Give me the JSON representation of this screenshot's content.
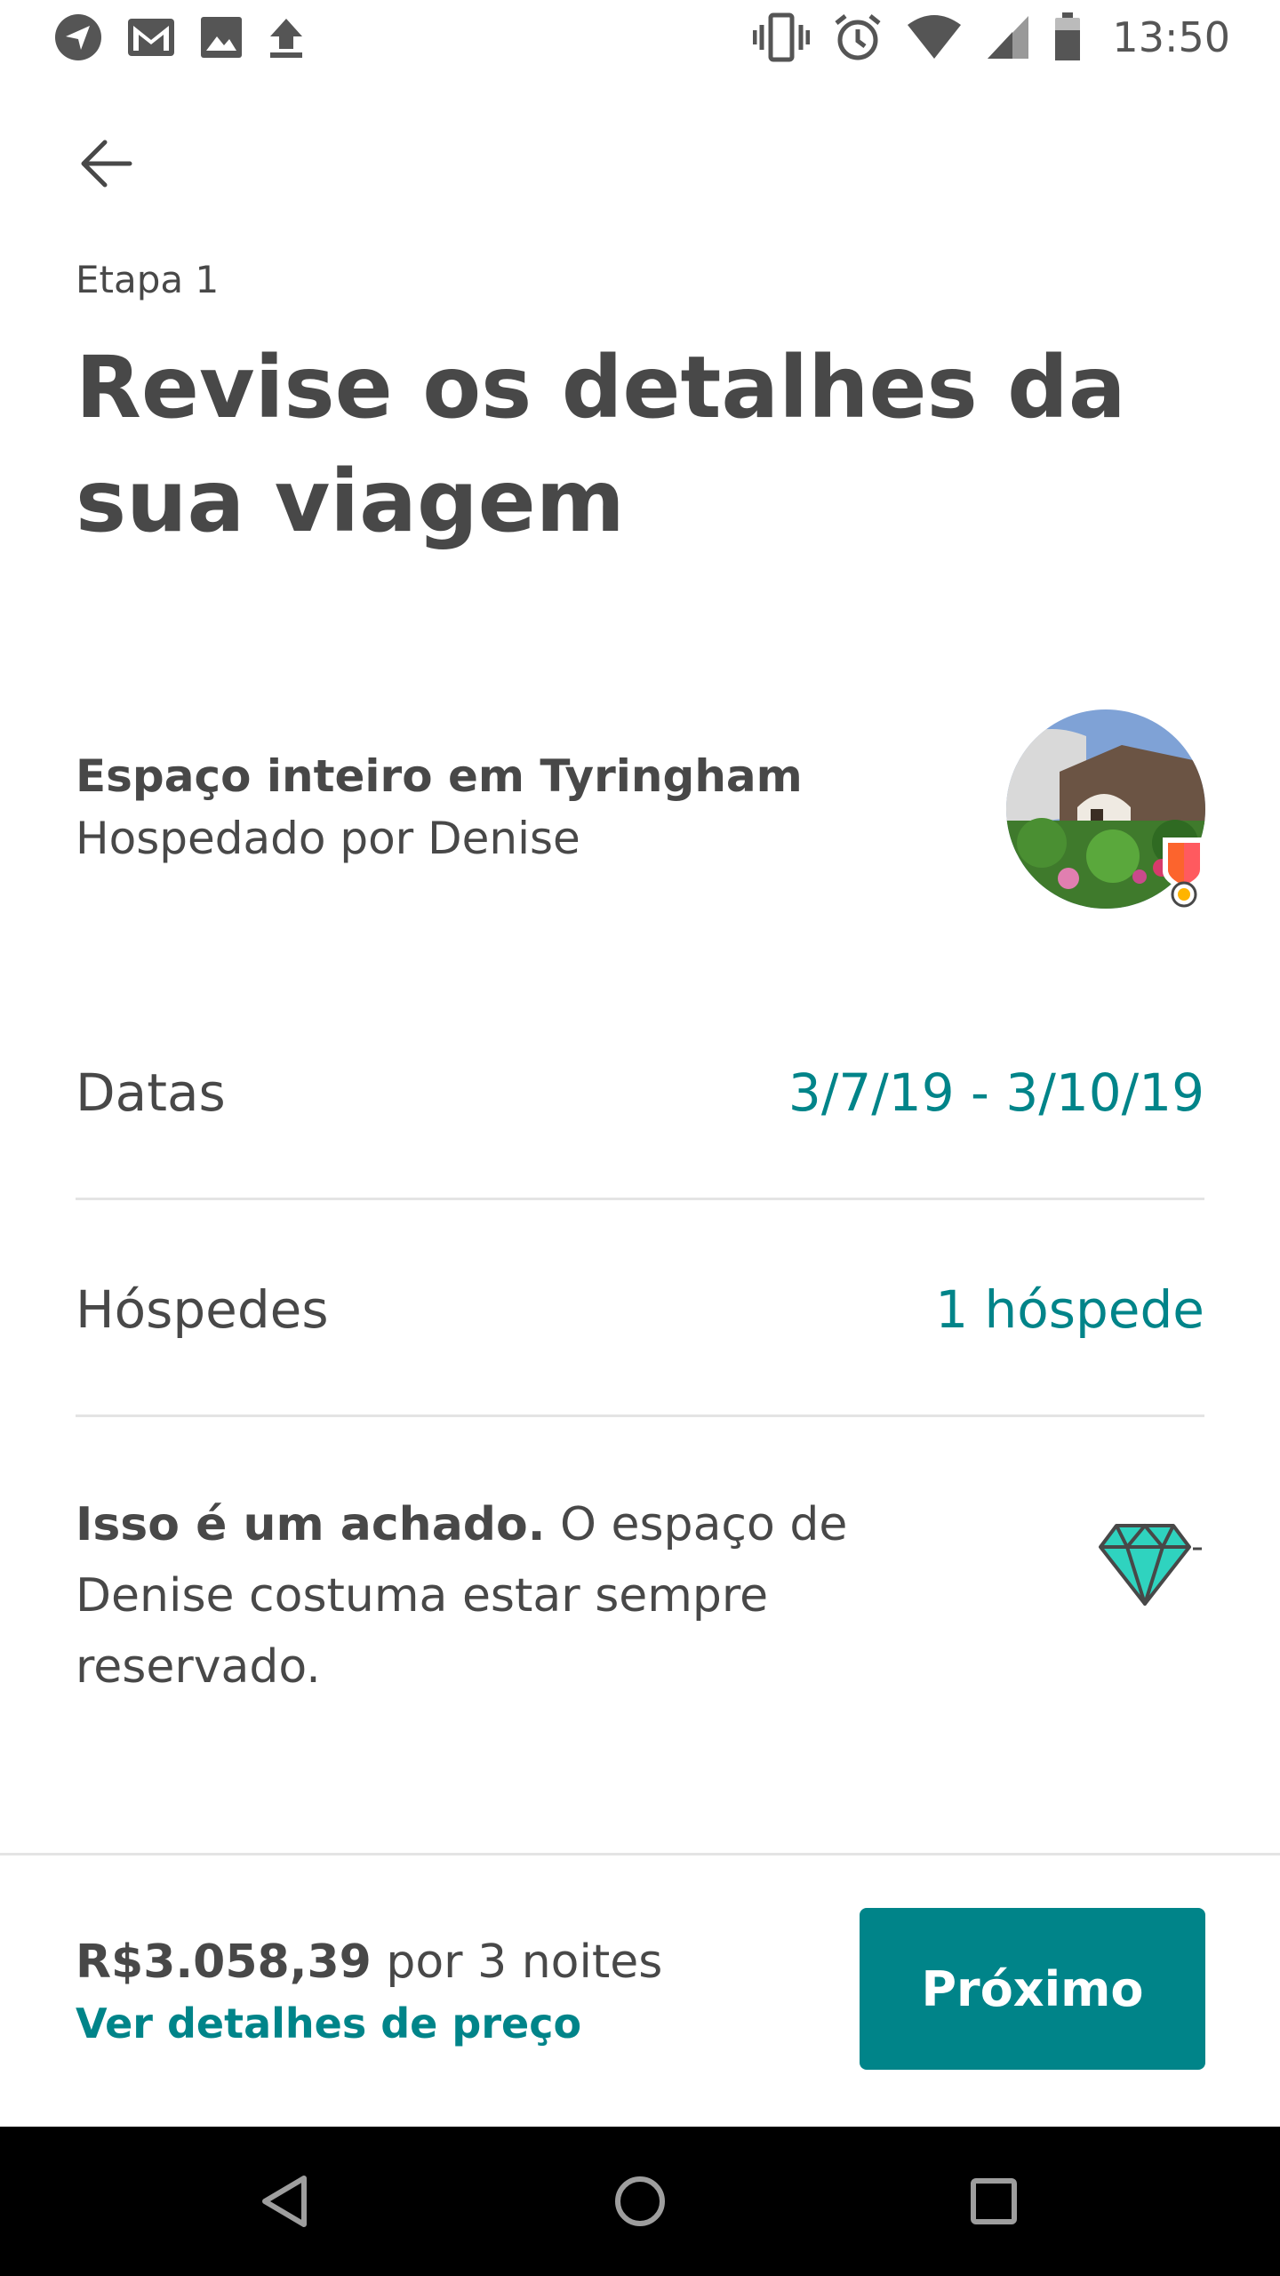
{
  "status_bar": {
    "time": "13:50",
    "left_icons": [
      "navigation-icon",
      "gmail-icon",
      "image-icon",
      "upload-icon"
    ],
    "right_icons": [
      "vibrate-icon",
      "alarm-icon",
      "wifi-icon",
      "signal-icon",
      "battery-icon"
    ]
  },
  "header": {
    "step": "Etapa 1",
    "title": "Revise os detalhes da sua viagem"
  },
  "listing": {
    "title": "Espaço inteiro em Tyringham",
    "host": "Hospedado por Denise"
  },
  "details": {
    "dates_label": "Datas",
    "dates_value": "3/7/19 - 3/10/19",
    "guests_label": "Hóspedes",
    "guests_value": "1 hóspede"
  },
  "notice": {
    "bold": "Isso é um achado.",
    "text": " O espaço de Denise costuma estar sempre reservado."
  },
  "footer": {
    "price": "R$3.058,39",
    "price_suffix": " por 3 noites",
    "price_link": "Ver detalhes de preço",
    "next_button": "Próximo"
  },
  "colors": {
    "accent": "#008489",
    "text": "#484848",
    "divider": "#e4e4e4"
  }
}
